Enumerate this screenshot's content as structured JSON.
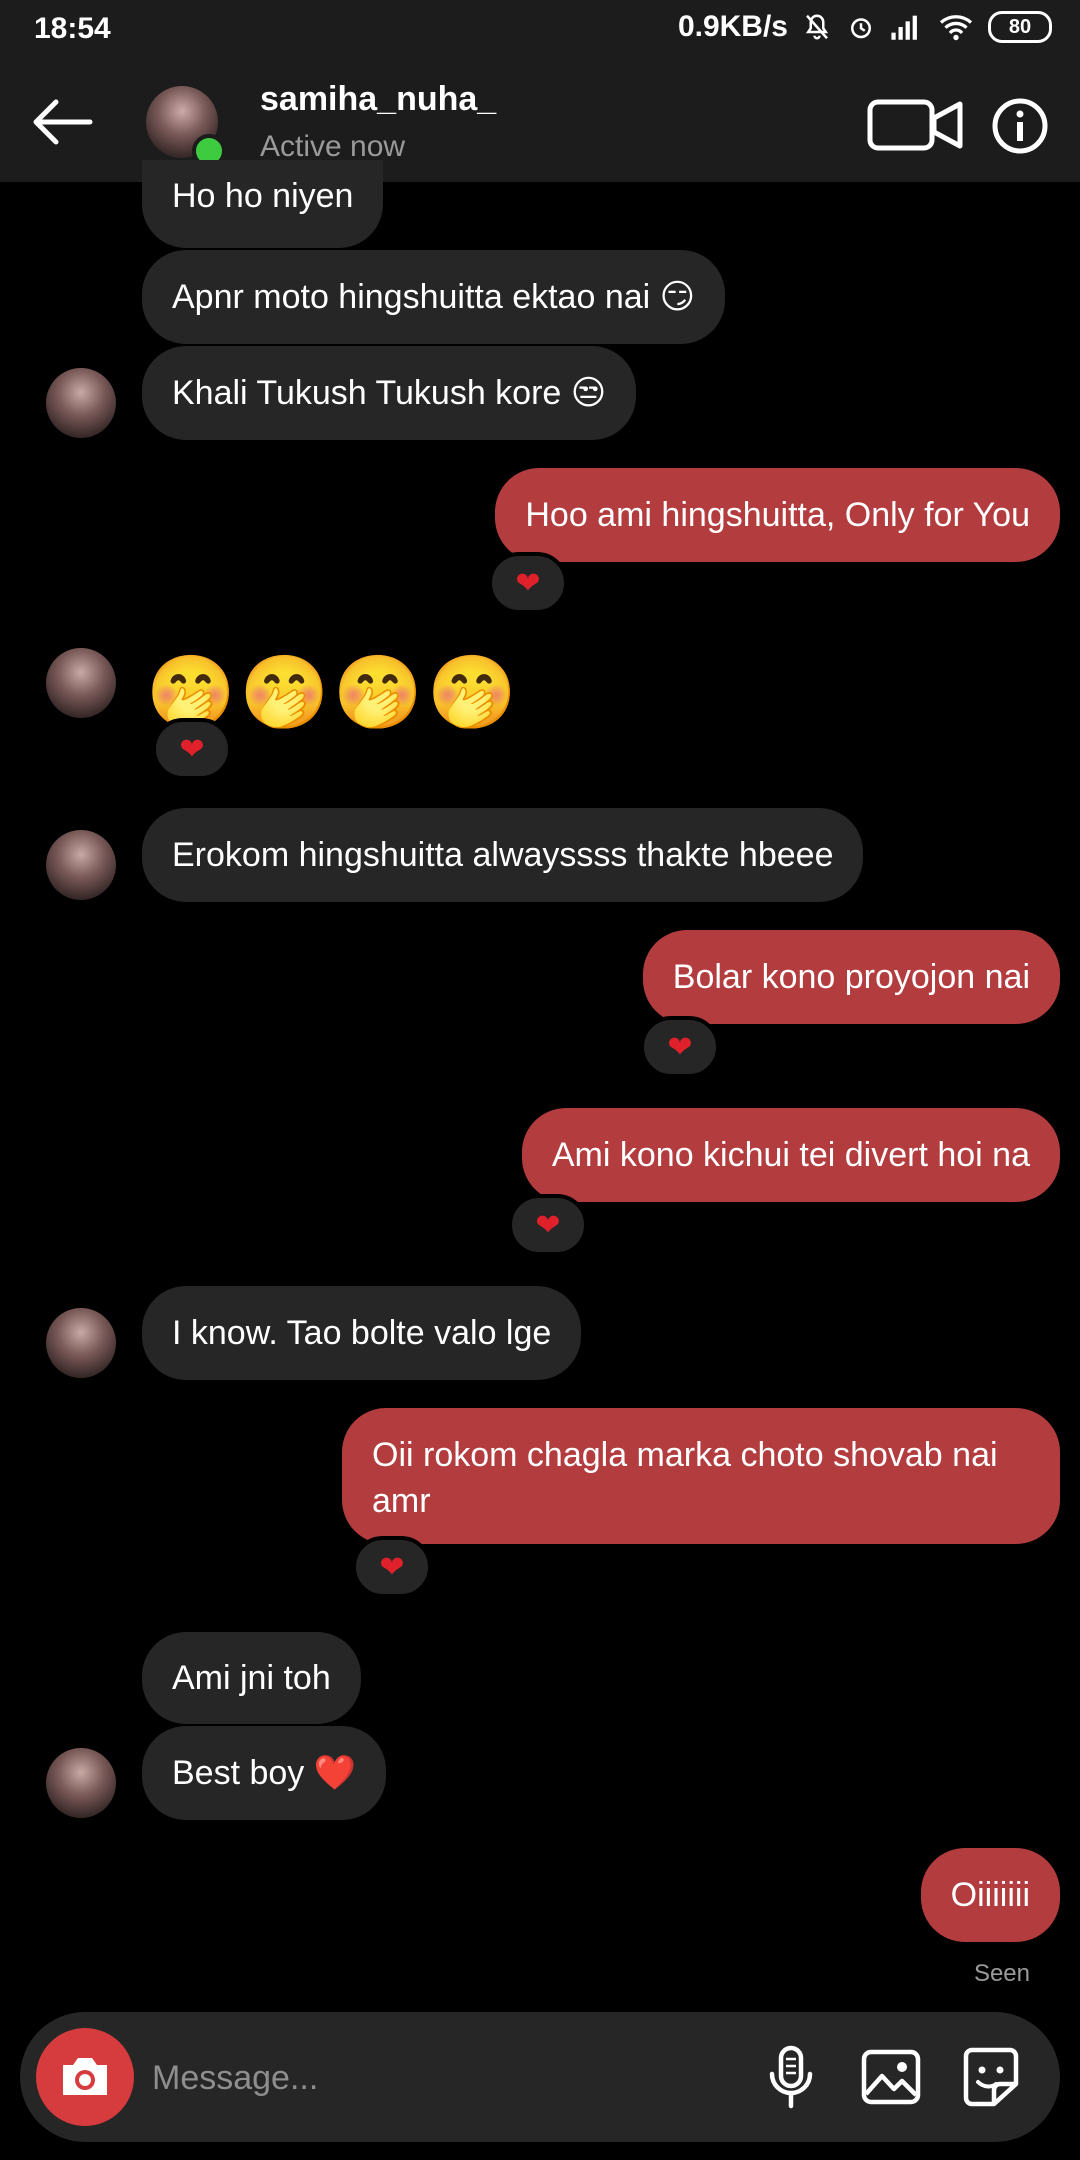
{
  "status_bar": {
    "time": "18:54",
    "speed": "0.9KB/s",
    "battery": "80"
  },
  "header": {
    "username": "samiha_nuha_",
    "status": "Active now"
  },
  "messages": [
    {
      "text": "Ho ho niyen"
    },
    {
      "text": "Apnr moto hingshuitta ektao nai 😏"
    },
    {
      "text": "Khali Tukush Tukush kore 😒"
    },
    {
      "text": "Hoo ami hingshuitta, Only for You"
    },
    {
      "text": "🤭🤭🤭🤭"
    },
    {
      "text": "Erokom hingshuitta alwayssss thakte hbeee"
    },
    {
      "text": "Bolar kono proyojon nai"
    },
    {
      "text": "Ami kono kichui tei divert hoi na"
    },
    {
      "text": "I know. Tao bolte valo lge"
    },
    {
      "text": "Oii rokom chagla marka choto shovab nai amr"
    },
    {
      "text": "Ami jni toh"
    },
    {
      "text": "Best boy ❤️"
    },
    {
      "text": "Oiiiiiii"
    }
  ],
  "reaction": "❤",
  "seen_label": "Seen",
  "composer": {
    "placeholder": "Message..."
  },
  "colors": {
    "outgoing_bubble": "#b33c3f",
    "incoming_bubble": "#262626",
    "camera_button": "#d63b3e",
    "online_dot": "#3fcb3f"
  }
}
